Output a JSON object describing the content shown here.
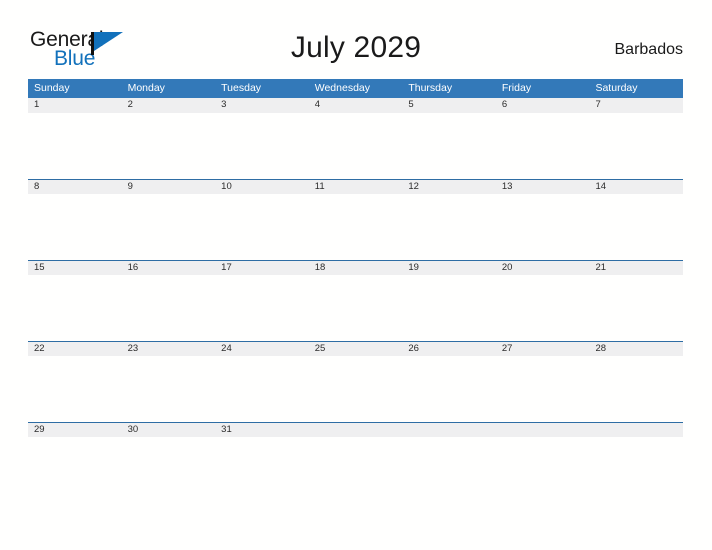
{
  "brand": {
    "name_part1": "General",
    "name_part2": "Blue",
    "flag_icon": "flag-icon"
  },
  "header": {
    "title": "July 2029",
    "country": "Barbados"
  },
  "colors": {
    "header_blue": "#3379b9",
    "row_divider_blue": "#2e6da4",
    "date_band_gray": "#efeff0",
    "brand_blue": "#1271bb",
    "text_dark": "#1a1a1a",
    "page_background": "#ffffff"
  },
  "calendar": {
    "weekdays": [
      "Sunday",
      "Monday",
      "Tuesday",
      "Wednesday",
      "Thursday",
      "Friday",
      "Saturday"
    ],
    "weeks": [
      {
        "days": [
          "1",
          "2",
          "3",
          "4",
          "5",
          "6",
          "7"
        ]
      },
      {
        "days": [
          "8",
          "9",
          "10",
          "11",
          "12",
          "13",
          "14"
        ]
      },
      {
        "days": [
          "15",
          "16",
          "17",
          "18",
          "19",
          "20",
          "21"
        ]
      },
      {
        "days": [
          "22",
          "23",
          "24",
          "25",
          "26",
          "27",
          "28"
        ]
      },
      {
        "days": [
          "29",
          "30",
          "31",
          "",
          "",
          "",
          ""
        ]
      }
    ]
  }
}
